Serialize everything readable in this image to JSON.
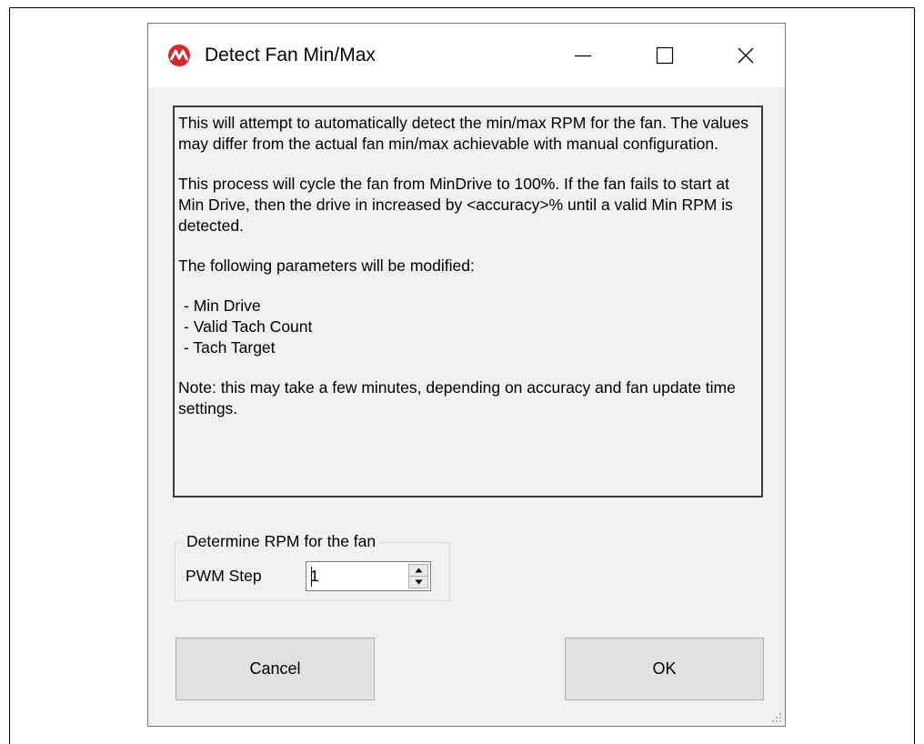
{
  "window": {
    "title": "Detect Fan Min/Max",
    "controls": {
      "minimize": "minimize-icon",
      "maximize": "maximize-icon",
      "close": "close-icon"
    }
  },
  "info": {
    "p1": "This will attempt to automatically detect the min/max RPM for the fan. The values may differ from the actual fan min/max achievable with manual configuration.",
    "p2": "This process will cycle the fan from MinDrive to 100%. If the fan fails to start at Min Drive, then the drive in increased by <accuracy>% until a valid Min RPM is detected.",
    "p3": "The following parameters will be modified:",
    "params": [
      " - Min Drive",
      " - Valid Tach Count",
      " - Tach Target"
    ],
    "p4": "Note: this may take a few minutes, depending on accuracy and fan update time settings."
  },
  "group": {
    "legend": "Determine RPM for the fan",
    "pwm_label": "PWM Step",
    "pwm_value": "1"
  },
  "buttons": {
    "cancel": "Cancel",
    "ok": "OK"
  },
  "colors": {
    "app_icon": "#d8262b"
  }
}
